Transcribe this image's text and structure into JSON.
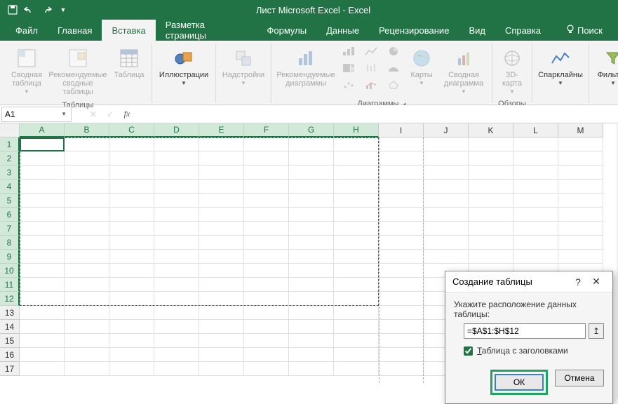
{
  "titlebar": {
    "title": "Лист Microsoft Excel - Excel"
  },
  "tabs": {
    "file": "Файл",
    "home": "Главная",
    "insert": "Вставка",
    "layout": "Разметка страницы",
    "formulas": "Формулы",
    "data": "Данные",
    "review": "Рецензирование",
    "view": "Вид",
    "help": "Справка",
    "search": "Поиск"
  },
  "ribbon": {
    "tables": {
      "label": "Таблицы",
      "pivot": "Сводная таблица",
      "recommended": "Рекомендуемые сводные таблицы",
      "table": "Таблица"
    },
    "illustrations": {
      "btn": "Иллюстрации"
    },
    "addins": {
      "btn": "Надстройки"
    },
    "charts": {
      "label": "Диаграммы",
      "recommended": "Рекомендуемые диаграммы",
      "maps": "Карты",
      "pivotchart": "Сводная диаграмма"
    },
    "tours": {
      "label": "Обзоры",
      "map3d": "3D-карта"
    },
    "sparklines": {
      "btn": "Спарклайны"
    },
    "filters": {
      "btn": "Фильтры"
    }
  },
  "namebox": {
    "value": "A1"
  },
  "formula": {
    "value": "",
    "fx": "fx"
  },
  "columns": [
    "A",
    "B",
    "C",
    "D",
    "E",
    "F",
    "G",
    "H",
    "I",
    "J",
    "K",
    "L",
    "M"
  ],
  "rows": [
    "1",
    "2",
    "3",
    "4",
    "5",
    "6",
    "7",
    "8",
    "9",
    "10",
    "11",
    "12",
    "13",
    "14",
    "15",
    "16",
    "17"
  ],
  "selected_cols": [
    "A",
    "B",
    "C",
    "D",
    "E",
    "F",
    "G",
    "H"
  ],
  "selected_rows": [
    "1",
    "2",
    "3",
    "4",
    "5",
    "6",
    "7",
    "8",
    "9",
    "10",
    "11",
    "12"
  ],
  "dialog": {
    "title": "Создание таблицы",
    "prompt": "Укажите расположение данных таблицы:",
    "range": "=$A$1:$H$12",
    "checkbox": "Таблица с заголовками",
    "ok": "ОК",
    "cancel": "Отмена"
  }
}
